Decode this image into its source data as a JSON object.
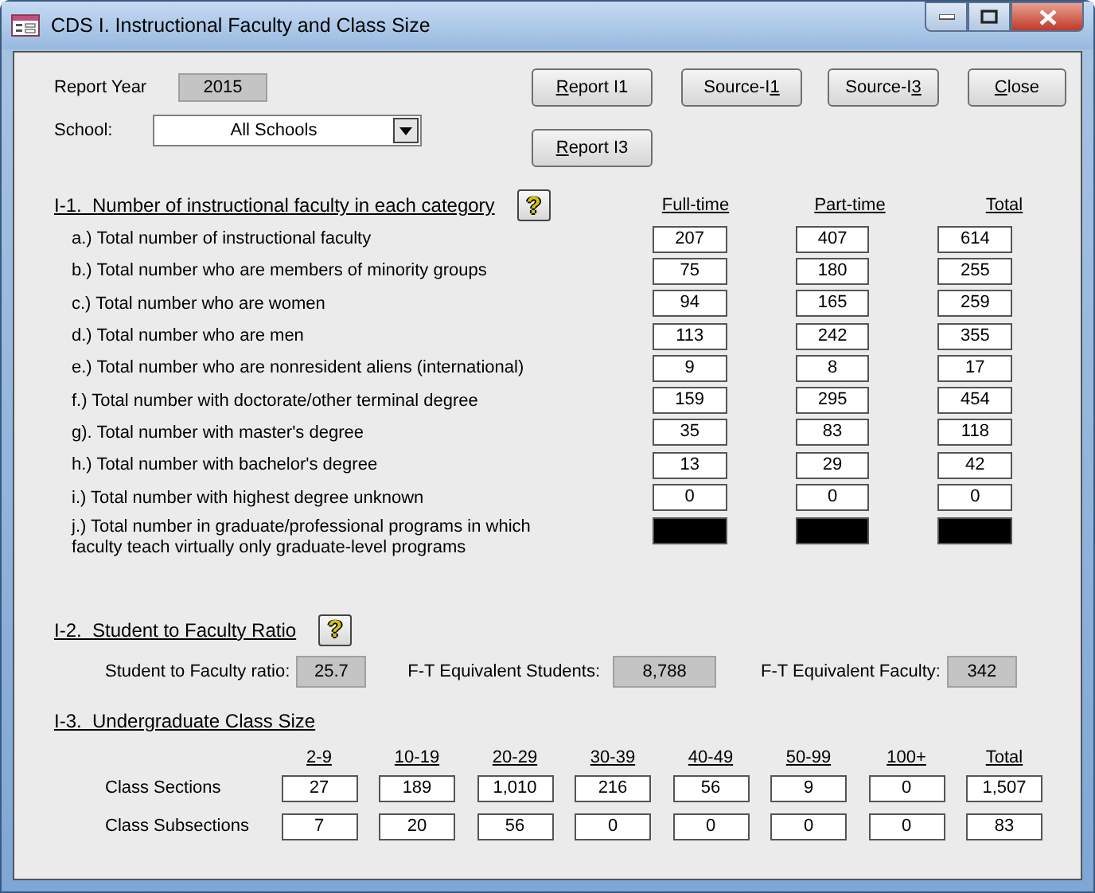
{
  "window": {
    "title": "CDS I. Instructional Faculty and Class Size"
  },
  "header": {
    "report_year_label": "Report Year",
    "report_year": "2015",
    "school_label": "School:",
    "school": "All Schools"
  },
  "buttons": [
    {
      "label_parts": [
        {
          "text": "R",
          "underlined": true
        },
        {
          "text": "eport I1",
          "underlined": false
        }
      ]
    },
    {
      "label_parts": [
        {
          "text": "Source-I",
          "underlined": false
        },
        {
          "text": "1",
          "underlined": true
        }
      ]
    },
    {
      "label_parts": [
        {
          "text": "Source-I",
          "underlined": false
        },
        {
          "text": "3",
          "underlined": true
        }
      ]
    },
    {
      "label_parts": [
        {
          "text": "C",
          "underlined": true
        },
        {
          "text": "lose",
          "underlined": false
        }
      ]
    },
    {
      "label_parts": [
        {
          "text": "R",
          "underlined": true
        },
        {
          "text": "eport I3",
          "underlined": false
        }
      ]
    }
  ],
  "help_buttons": [
    {
      "label": "?"
    },
    {
      "label": "?"
    }
  ],
  "faculty": {
    "heading": "I-1.  Number of instructional faculty in each category",
    "columns": [
      "Full-time",
      "Part-time",
      "Total"
    ],
    "rows": [
      {
        "label": "a.)  Total number of instructional faculty",
        "values": [
          "207",
          "407",
          "614"
        ],
        "blacked_out": false
      },
      {
        "label": "b.)  Total number who are members of minority groups",
        "values": [
          "75",
          "180",
          "255"
        ],
        "blacked_out": false
      },
      {
        "label": "c.)  Total number who are women",
        "values": [
          "94",
          "165",
          "259"
        ],
        "blacked_out": false
      },
      {
        "label": "d.)  Total number who are men",
        "values": [
          "113",
          "242",
          "355"
        ],
        "blacked_out": false
      },
      {
        "label": "e.)  Total number who are nonresident aliens (international)",
        "values": [
          "9",
          "8",
          "17"
        ],
        "blacked_out": false
      },
      {
        "label": "f.)  Total number with doctorate/other terminal degree",
        "values": [
          "159",
          "295",
          "454"
        ],
        "blacked_out": false
      },
      {
        "label": "g).  Total number with master's degree",
        "values": [
          "35",
          "83",
          "118"
        ],
        "blacked_out": false
      },
      {
        "label": "h.)  Total number with bachelor's degree",
        "values": [
          "13",
          "29",
          "42"
        ],
        "blacked_out": false
      },
      {
        "label": "i.)  Total number with highest degree unknown",
        "values": [
          "0",
          "0",
          "0"
        ],
        "blacked_out": false
      },
      {
        "label": "j.)  Total number in graduate/professional programs in which faculty teach virtually only graduate-level programs",
        "values": [],
        "blacked_out": true
      }
    ]
  },
  "ratio": {
    "heading": "I-2.  Student to Faculty Ratio",
    "fields": [
      {
        "label": "Student to Faculty ratio:",
        "value": "25.7"
      },
      {
        "label": "F-T Equivalent Students:",
        "value": "8,788"
      },
      {
        "label": "F-T Equivalent Faculty:",
        "value": "342"
      }
    ]
  },
  "class_size": {
    "heading": "I-3.  Undergraduate Class Size",
    "columns": [
      "2-9",
      "10-19",
      "20-29",
      "30-39",
      "40-49",
      "50-99",
      "100+",
      "Total"
    ],
    "rows": [
      {
        "label": "Class Sections",
        "values": [
          "27",
          "189",
          "1,010",
          "216",
          "56",
          "9",
          "0",
          "1,507"
        ]
      },
      {
        "label": "Class Subsections",
        "values": [
          "7",
          "20",
          "56",
          "0",
          "0",
          "0",
          "0",
          "83"
        ]
      }
    ]
  }
}
